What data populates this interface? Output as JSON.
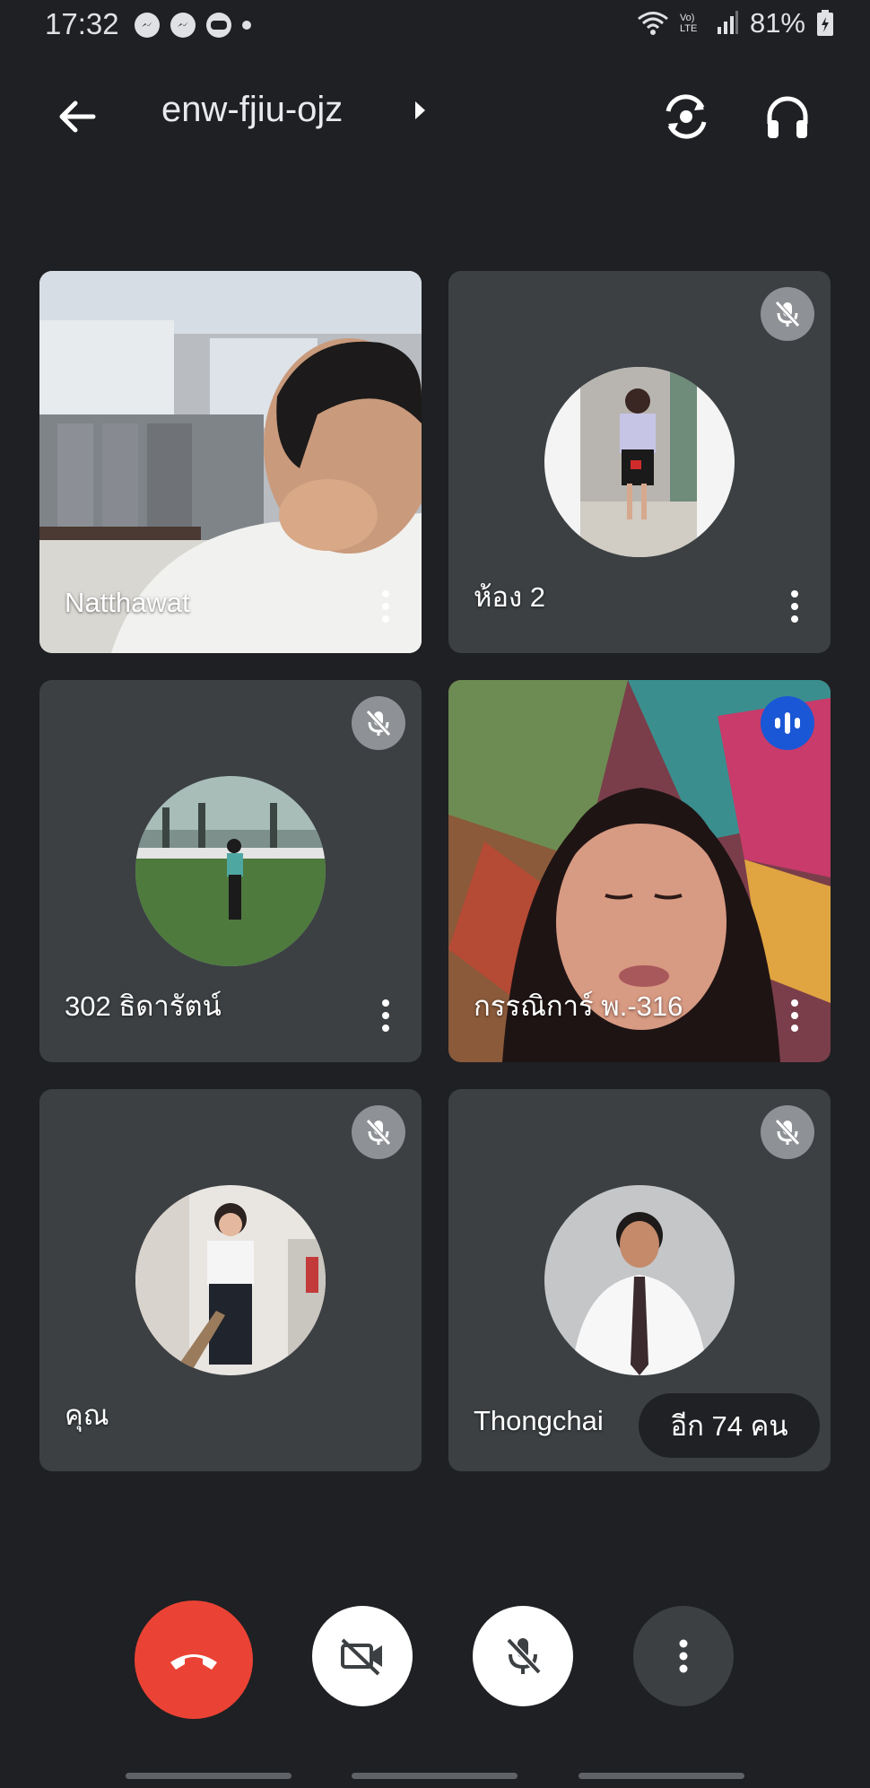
{
  "status_bar": {
    "time": "17:32",
    "apps": [
      "messenger-icon",
      "messenger-icon",
      "line-icon"
    ],
    "network": "Vo) LTE",
    "battery": "81%"
  },
  "top_bar": {
    "meeting_code": "enw-fjiu-ojz"
  },
  "participants": [
    {
      "name": "Natthawat",
      "video": true,
      "muted": false,
      "speaking": false
    },
    {
      "name": "ห้อง 2",
      "video": false,
      "muted": true,
      "speaking": false
    },
    {
      "name": "302 ธิดารัตน์",
      "video": false,
      "muted": true,
      "speaking": false
    },
    {
      "name": "กรรณิการ์ พ.-316",
      "video": true,
      "muted": false,
      "speaking": true
    },
    {
      "name": "คุณ",
      "video": false,
      "muted": true,
      "speaking": false
    },
    {
      "name": "Thongchai",
      "video": false,
      "muted": true,
      "speaking": false
    }
  ],
  "more_participants_label": "อีก 74 คน",
  "colors": {
    "background": "#1f2023",
    "tile": "#3c4043",
    "end_call": "#ea4335",
    "speaking_badge": "#1a57d6"
  }
}
